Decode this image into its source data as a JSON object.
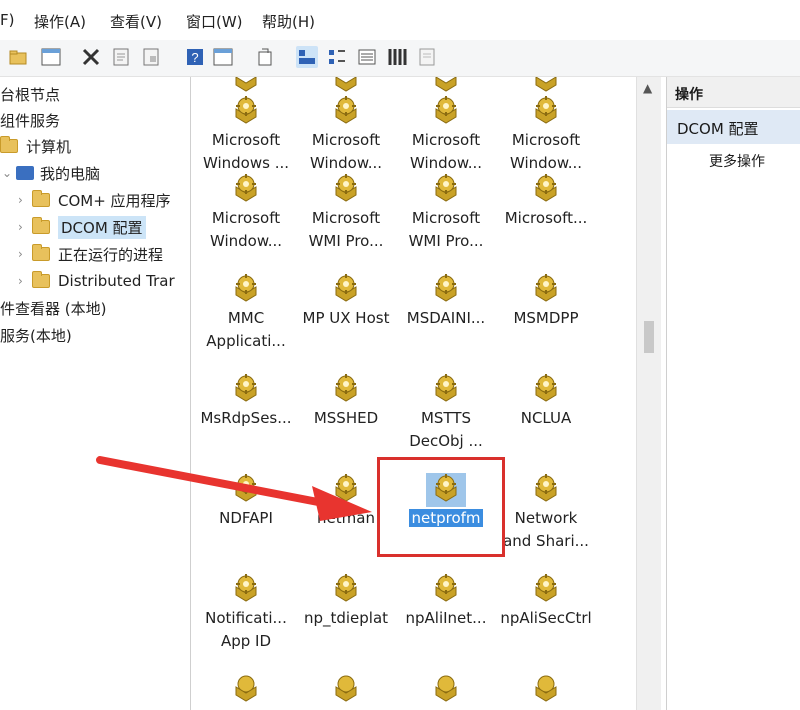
{
  "menu": [
    "F)",
    "操作(A)",
    "查看(V)",
    "窗口(W)",
    "帮助(H)"
  ],
  "toolbar_icons": [
    "folder-open-icon",
    "view-icon",
    "delete-icon",
    "properties-icon",
    "export-icon",
    "help-icon",
    "view-icon",
    "refresh-icon",
    "large-icons-icon",
    "small-icons-icon",
    "list-icon",
    "details-icon",
    "detail-view-icon"
  ],
  "tree": [
    {
      "label": "台根节点",
      "level": 0
    },
    {
      "label": "组件服务",
      "level": 0
    },
    {
      "label": "计算机",
      "level": 1
    },
    {
      "label": "我的电脑",
      "level": 1
    },
    {
      "label": "COM+ 应用程序",
      "level": 2
    },
    {
      "label": "DCOM 配置",
      "level": 2,
      "selected": true
    },
    {
      "label": "正在运行的进程",
      "level": 2
    },
    {
      "label": "Distributed Trar",
      "level": 2
    },
    {
      "label": "件查看器 (本地)",
      "level": 0
    },
    {
      "label": "服务(本地)",
      "level": 0
    }
  ],
  "apps": [
    {
      "line1": "Microsoft",
      "line2": "Windows ..."
    },
    {
      "line1": "Microsoft",
      "line2": "Window..."
    },
    {
      "line1": "Microsoft",
      "line2": "Window..."
    },
    {
      "line1": "Microsoft",
      "line2": "Window..."
    },
    {
      "line1": "Microsoft",
      "line2": "Window..."
    },
    {
      "line1": "Microsoft",
      "line2": "WMI Pro..."
    },
    {
      "line1": "Microsoft",
      "line2": "WMI Pro..."
    },
    {
      "line1": "Microsoft...",
      "line2": ""
    },
    {
      "line1": "MMC",
      "line2": "Applicati..."
    },
    {
      "line1": "MP UX Host",
      "line2": ""
    },
    {
      "line1": "MSDAINI...",
      "line2": ""
    },
    {
      "line1": "MSMDPP",
      "line2": ""
    },
    {
      "line1": "MsRdpSes...",
      "line2": ""
    },
    {
      "line1": "MSSHED",
      "line2": ""
    },
    {
      "line1": "MSTTS",
      "line2": "DecObj ..."
    },
    {
      "line1": "NCLUA",
      "line2": ""
    },
    {
      "line1": "NDFAPI",
      "line2": ""
    },
    {
      "line1": "netman",
      "line2": ""
    },
    {
      "line1": "netprofm",
      "line2": "",
      "selected": true
    },
    {
      "line1": "Network",
      "line2": "and Shari..."
    },
    {
      "line1": "Notificati...",
      "line2": "App ID"
    },
    {
      "line1": "np_tdieplat",
      "line2": ""
    },
    {
      "line1": "npAliInet...",
      "line2": ""
    },
    {
      "line1": "npAliSecCtrl",
      "line2": ""
    }
  ],
  "actions_panel": {
    "header": "操作",
    "selected": "DCOM 配置",
    "more": "更多操作"
  },
  "colors": {
    "highlight_box": "#d9302c",
    "arrow": "#e8342f",
    "selection": "#3b8de0"
  }
}
